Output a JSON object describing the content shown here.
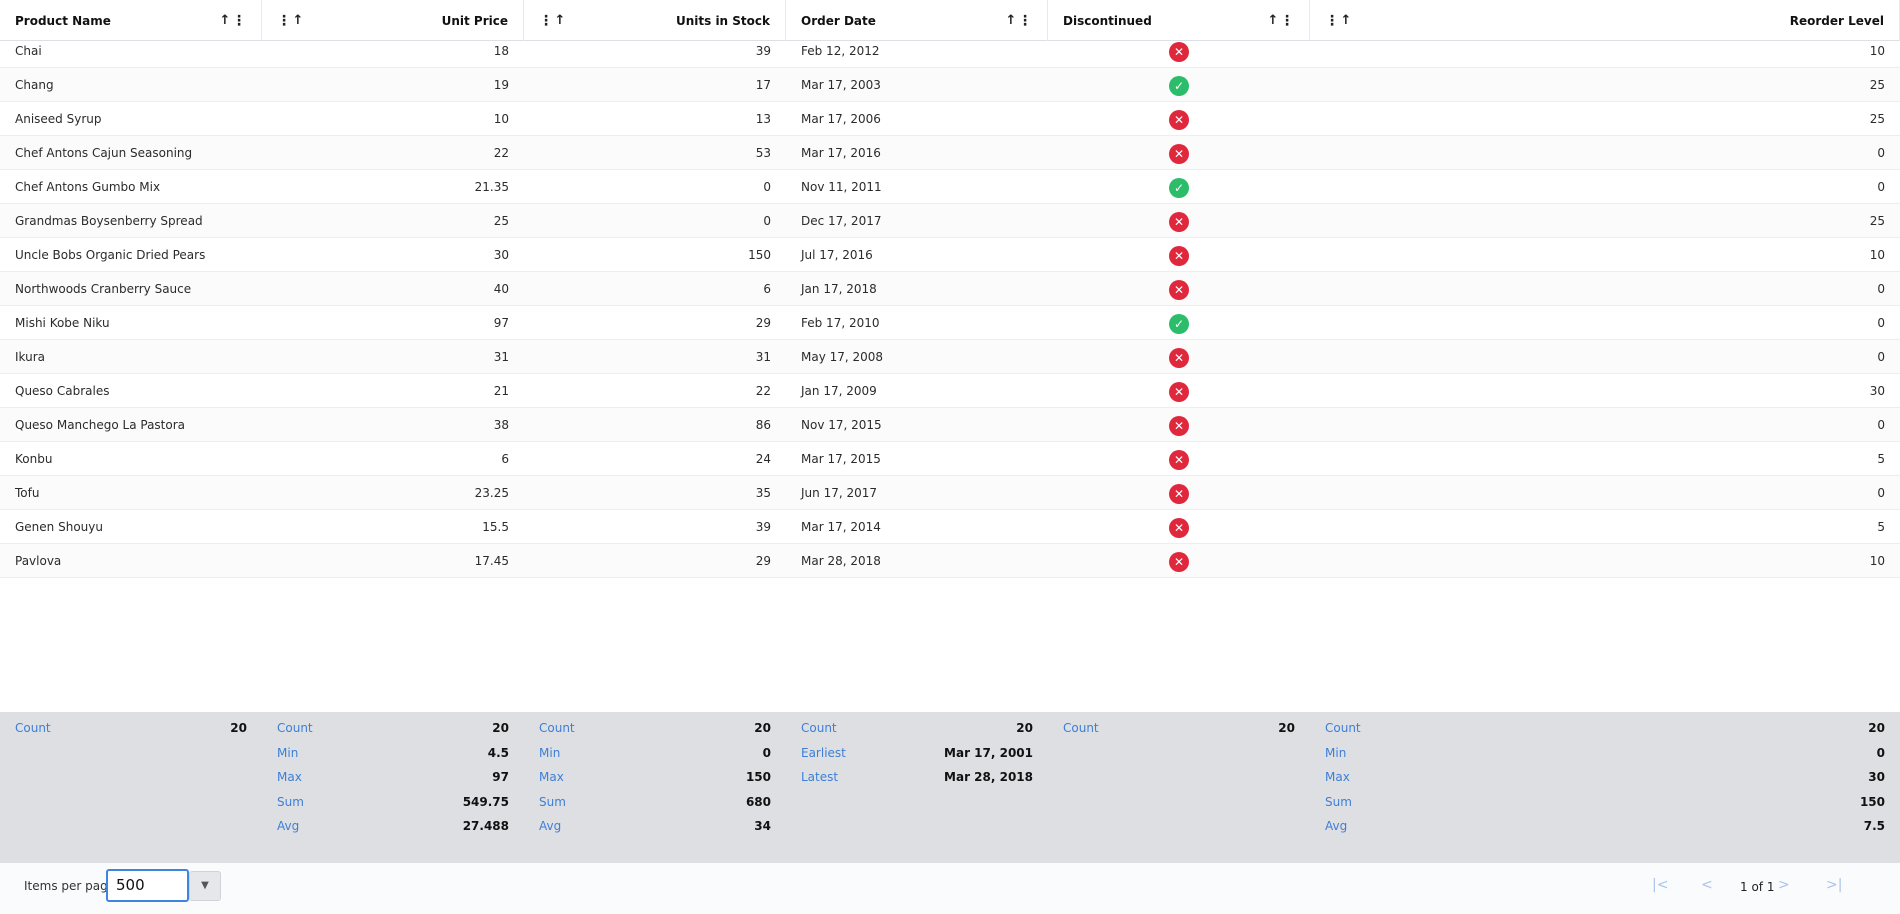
{
  "columns": [
    {
      "label": "Product Name"
    },
    {
      "label": "Unit Price"
    },
    {
      "label": "Units in Stock"
    },
    {
      "label": "Order Date"
    },
    {
      "label": "Discontinued"
    },
    {
      "label": "Reorder Level"
    }
  ],
  "rows": [
    {
      "name": "Chai",
      "price": "18",
      "stock": "39",
      "date": "Feb 12, 2012",
      "discontinued": "x-icon",
      "reorder": "10"
    },
    {
      "name": "Chang",
      "price": "19",
      "stock": "17",
      "date": "Mar 17, 2003",
      "discontinued": "check-icon",
      "reorder": "25"
    },
    {
      "name": "Aniseed Syrup",
      "price": "10",
      "stock": "13",
      "date": "Mar 17, 2006",
      "discontinued": "x-icon",
      "reorder": "25"
    },
    {
      "name": "Chef Antons Cajun Seasoning",
      "price": "22",
      "stock": "53",
      "date": "Mar 17, 2016",
      "discontinued": "x-icon",
      "reorder": "0"
    },
    {
      "name": "Chef Antons Gumbo Mix",
      "price": "21.35",
      "stock": "0",
      "date": "Nov 11, 2011",
      "discontinued": "check-icon",
      "reorder": "0"
    },
    {
      "name": "Grandmas Boysenberry Spread",
      "price": "25",
      "stock": "0",
      "date": "Dec 17, 2017",
      "discontinued": "x-icon",
      "reorder": "25"
    },
    {
      "name": "Uncle Bobs Organic Dried Pears",
      "price": "30",
      "stock": "150",
      "date": "Jul 17, 2016",
      "discontinued": "x-icon",
      "reorder": "10"
    },
    {
      "name": "Northwoods Cranberry Sauce",
      "price": "40",
      "stock": "6",
      "date": "Jan 17, 2018",
      "discontinued": "x-icon",
      "reorder": "0"
    },
    {
      "name": "Mishi Kobe Niku",
      "price": "97",
      "stock": "29",
      "date": "Feb 17, 2010",
      "discontinued": "check-icon",
      "reorder": "0"
    },
    {
      "name": "Ikura",
      "price": "31",
      "stock": "31",
      "date": "May 17, 2008",
      "discontinued": "x-icon",
      "reorder": "0"
    },
    {
      "name": "Queso Cabrales",
      "price": "21",
      "stock": "22",
      "date": "Jan 17, 2009",
      "discontinued": "x-icon",
      "reorder": "30"
    },
    {
      "name": "Queso Manchego La Pastora",
      "price": "38",
      "stock": "86",
      "date": "Nov 17, 2015",
      "discontinued": "x-icon",
      "reorder": "0"
    },
    {
      "name": "Konbu",
      "price": "6",
      "stock": "24",
      "date": "Mar 17, 2015",
      "discontinued": "x-icon",
      "reorder": "5"
    },
    {
      "name": "Tofu",
      "price": "23.25",
      "stock": "35",
      "date": "Jun 17, 2017",
      "discontinued": "x-icon",
      "reorder": "0"
    },
    {
      "name": "Genen Shouyu",
      "price": "15.5",
      "stock": "39",
      "date": "Mar 17, 2014",
      "discontinued": "x-icon",
      "reorder": "5"
    },
    {
      "name": "Pavlova",
      "price": "17.45",
      "stock": "29",
      "date": "Mar 28, 2018",
      "discontinued": "x-icon",
      "reorder": "10"
    }
  ],
  "summaries": [
    [
      {
        "k": "Count",
        "v": "20"
      }
    ],
    [
      {
        "k": "Count",
        "v": "20"
      },
      {
        "k": "Min",
        "v": "4.5"
      },
      {
        "k": "Max",
        "v": "97"
      },
      {
        "k": "Sum",
        "v": "549.75"
      },
      {
        "k": "Avg",
        "v": "27.488"
      }
    ],
    [
      {
        "k": "Count",
        "v": "20"
      },
      {
        "k": "Min",
        "v": "0"
      },
      {
        "k": "Max",
        "v": "150"
      },
      {
        "k": "Sum",
        "v": "680"
      },
      {
        "k": "Avg",
        "v": "34"
      }
    ],
    [
      {
        "k": "Count",
        "v": "20"
      },
      {
        "k": "Earliest",
        "v": "Mar 17, 2001"
      },
      {
        "k": "Latest",
        "v": "Mar 28, 2018"
      }
    ],
    [
      {
        "k": "Count",
        "v": "20"
      }
    ],
    [
      {
        "k": "Count",
        "v": "20"
      },
      {
        "k": "Min",
        "v": "0"
      },
      {
        "k": "Max",
        "v": "30"
      },
      {
        "k": "Sum",
        "v": "150"
      },
      {
        "k": "Avg",
        "v": "7.5"
      }
    ]
  ],
  "footer": {
    "items_per_page_label": "Items per page",
    "items_per_page_value": "500",
    "page_info": "1 of 1"
  },
  "colors": {
    "accent": "#3d86e0",
    "discontinued_yes": "#e0283d",
    "discontinued_no": "#2bbd6a",
    "summary_bg": "#dedfe3"
  }
}
